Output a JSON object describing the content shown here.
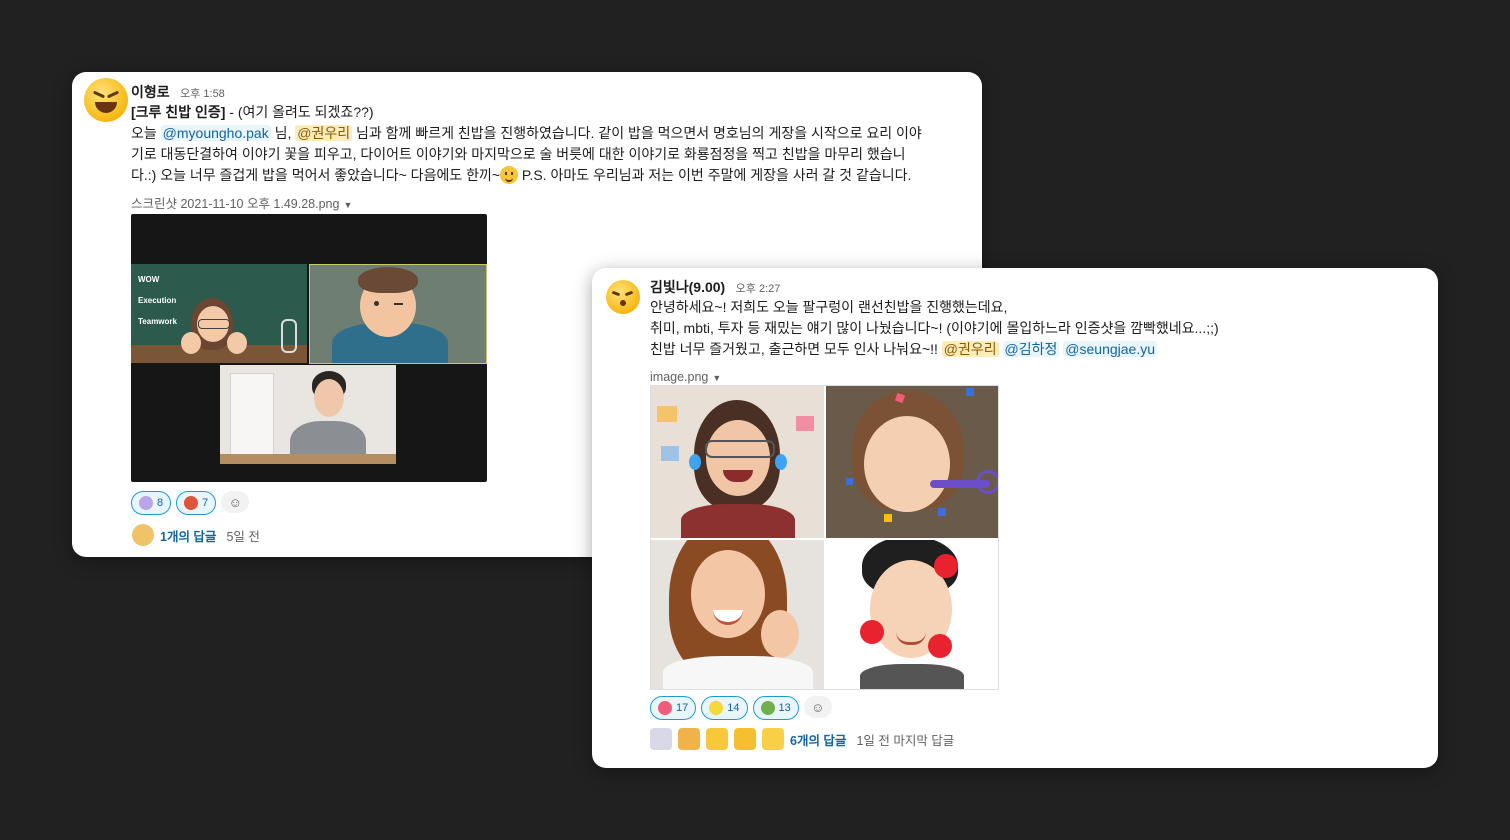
{
  "message1": {
    "author": "이형로",
    "time": "오후 1:58",
    "title_bold": "[크루 친밥 인증]",
    "title_rest": " - (여기 올려도 되겠죠??)",
    "line1_a": "오늘 ",
    "mention1": "@myoungho.pak",
    "line1_b": " 님, ",
    "mention2": "@권우리",
    "line1_c": " 님과 함께 빠르게 친밥을 진행하였습니다. 같이 밥을 먹으면서 명호님의 게장을 시작으로 요리 이야",
    "line2": "기로 대동단결하여 이야기 꽃을 피우고, 다이어트 이야기와 마지막으로 술 버릇에 대한 이야기로 화룡점정을 찍고 친밥을 마무리 했습니",
    "line3_a": "다.:) 오늘 너무 즐겁게 밥을 먹어서 좋았습니다~ 다음에도 한끼~",
    "line3_b": " P.S. 아마도 우리님과 저는 이번 주말에 게장을 사러 갈 것 같습니다.",
    "file_name": "스크린샷 2021-11-10 오후 1.49.28.png",
    "slide_lines": [
      "WOW",
      "Execution",
      "Teamwork"
    ],
    "reactions": [
      {
        "emoji": "cat-face",
        "count": "8",
        "color": "#b9a6e8"
      },
      {
        "emoji": "crab",
        "count": "7",
        "color": "#e0553a"
      }
    ],
    "replies": "1개의 답글",
    "replies_meta": "5일 전"
  },
  "message2": {
    "author": "김빛나(9.00)",
    "time": "오후 2:27",
    "line1": "안녕하세요~! 저희도 오늘 팔구렁이 랜선친밥을 진행했는데요,",
    "line2": "취미, mbti, 투자 등 재밌는 얘기 많이 나눴습니다~! (이야기에 몰입하느라 인증샷을 깜빡했네요...;;)",
    "line3_a": "친밥 너무 즐거웠고, 출근하면 모두 인사 나눠요~!! ",
    "mention1": "@권우리",
    "mention2": "@김하정",
    "mention3": "@seungjae.yu",
    "file_name": "image.png",
    "reactions": [
      {
        "emoji": "heart-eyes",
        "count": "17",
        "color": "#f25c7a"
      },
      {
        "emoji": "pikachu",
        "count": "14",
        "color": "#f7d83a"
      },
      {
        "emoji": "snake",
        "count": "13",
        "color": "#6fb04a"
      }
    ],
    "replies": "6개의 답글",
    "replies_meta": "1일 전 마지막 답글"
  },
  "colors": {
    "background": "#212121",
    "link": "#1264a3",
    "mention_self_bg": "#fcecbc"
  }
}
